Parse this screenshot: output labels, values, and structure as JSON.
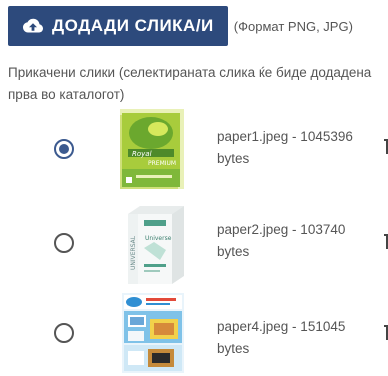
{
  "upload": {
    "button_label": "ДОДАДИ СЛИКА/И",
    "format_note": "(Формат PNG, JPG)",
    "button_color": "#2d4a7c",
    "icon": "cloud-upload-icon"
  },
  "attached": {
    "caption": "Прикачени слики (селектираната слика ќе биде додадена прва во каталогот)"
  },
  "images": [
    {
      "filename": "paper1.jpeg - 1045396 bytes",
      "selected": true,
      "thumb_icon": "paper-pack-green-icon"
    },
    {
      "filename": "paper2.jpeg - 103740 bytes",
      "selected": false,
      "thumb_icon": "paper-pack-white-icon"
    },
    {
      "filename": "paper4.jpeg - 151045 bytes",
      "selected": false,
      "thumb_icon": "photo-paper-pack-icon"
    }
  ],
  "accent_color": "#3c5a8f",
  "delete_icon": "trash-icon"
}
